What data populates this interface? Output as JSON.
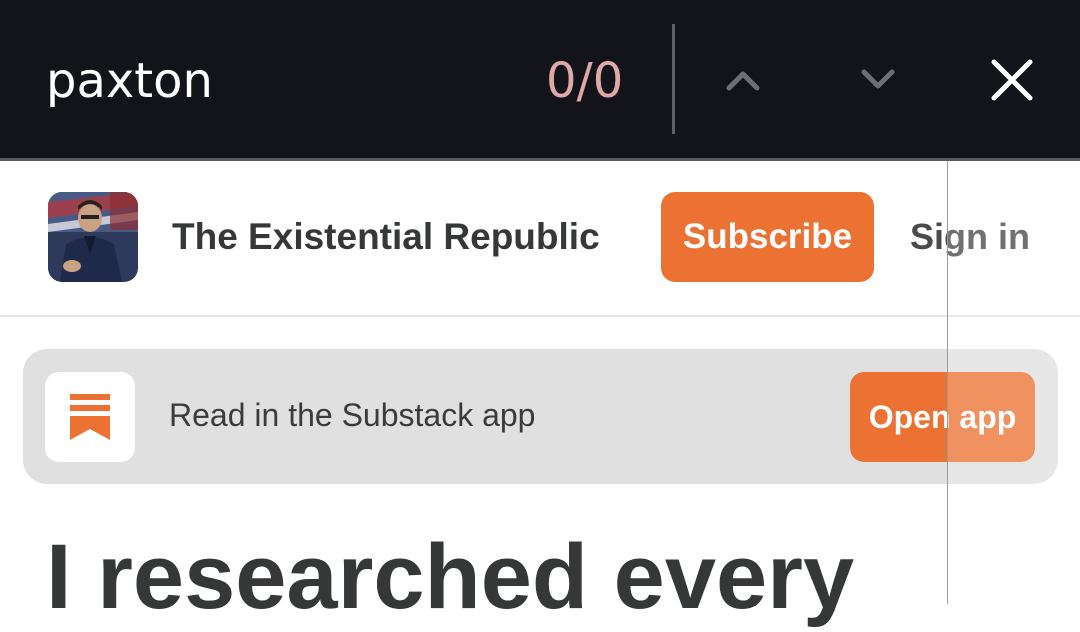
{
  "find_bar": {
    "query": "paxton",
    "match_count": "0/0",
    "prev_icon": "chevron-up-icon",
    "next_icon": "chevron-down-icon",
    "close_icon": "close-icon"
  },
  "header": {
    "publication_name": "The Existential Republic",
    "subscribe_label": "Subscribe",
    "signin_label": "Sign in"
  },
  "app_banner": {
    "icon": "substack-logo-icon",
    "text": "Read in the Substack app",
    "button_label": "Open app"
  },
  "article": {
    "headline": "I researched every"
  },
  "colors": {
    "find_bar_bg": "#131419",
    "accent": "#ec7234",
    "banner_bg": "#e0e0e0",
    "match_count": "#e0a8a8"
  }
}
